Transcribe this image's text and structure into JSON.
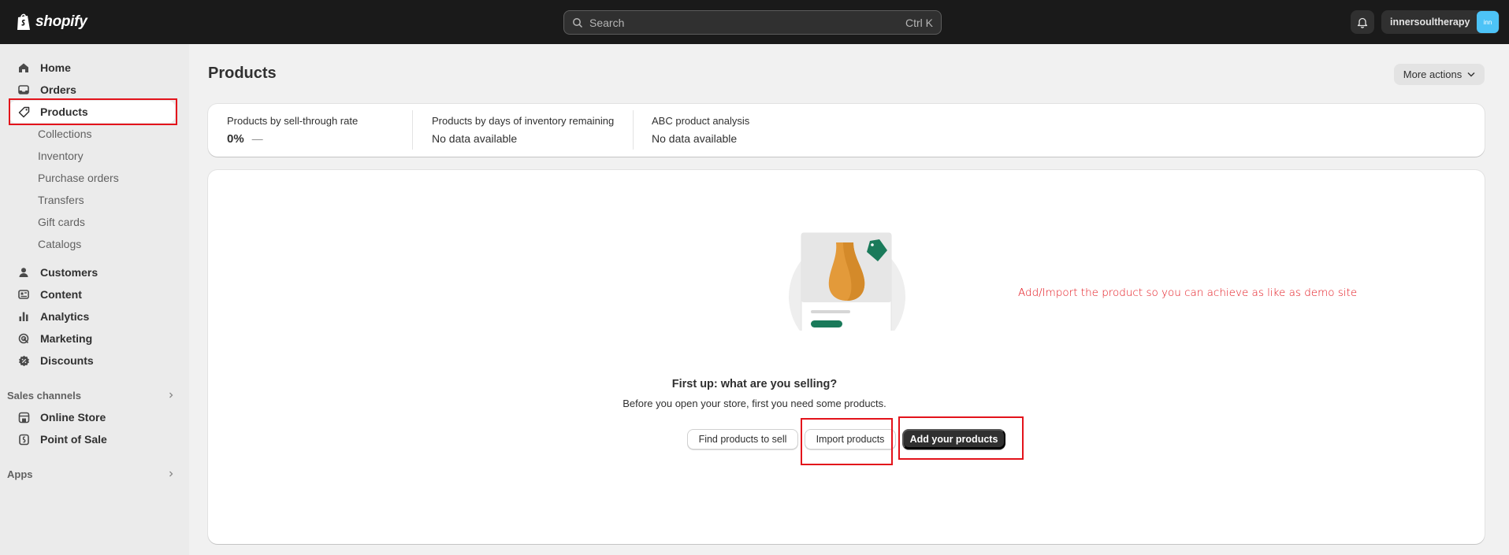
{
  "topbar": {
    "logo_text": "shopify",
    "search_placeholder": "Search",
    "search_shortcut": "Ctrl K",
    "store_name": "innersoultherapy",
    "avatar_initials": "inn"
  },
  "sidebar": {
    "main_items": [
      {
        "label": "Home",
        "icon": "home-icon"
      },
      {
        "label": "Orders",
        "icon": "inbox-icon"
      },
      {
        "label": "Products",
        "icon": "tag-icon",
        "active": true
      }
    ],
    "product_subitems": [
      "Collections",
      "Inventory",
      "Purchase orders",
      "Transfers",
      "Gift cards",
      "Catalogs"
    ],
    "more_items": [
      {
        "label": "Customers",
        "icon": "person-icon"
      },
      {
        "label": "Content",
        "icon": "content-icon"
      },
      {
        "label": "Analytics",
        "icon": "bar-chart-icon"
      },
      {
        "label": "Marketing",
        "icon": "target-icon"
      },
      {
        "label": "Discounts",
        "icon": "discount-icon"
      }
    ],
    "sales_channels_label": "Sales channels",
    "sales_channels": [
      {
        "label": "Online Store",
        "icon": "store-icon"
      },
      {
        "label": "Point of Sale",
        "icon": "pos-icon"
      }
    ],
    "apps_label": "Apps"
  },
  "main": {
    "title": "Products",
    "more_actions_label": "More actions",
    "metrics": [
      {
        "label": "Products by sell-through rate",
        "value": "0%",
        "trend": "—"
      },
      {
        "label": "Products by days of inventory remaining",
        "value": "No data available"
      },
      {
        "label": "ABC product analysis",
        "value": "No data available"
      }
    ],
    "empty_state": {
      "heading": "First up: what are you selling?",
      "subtext": "Before you open your store, first you need some products.",
      "find_button": "Find products to sell",
      "import_button": "Import products",
      "add_button": "Add your products"
    }
  },
  "annotation": {
    "text": "Add/Import the product so you can achieve as like as demo site",
    "color": "#e3131b"
  },
  "colors": {
    "topbar": "#1a1a1a",
    "sidebar": "#ebebeb",
    "page": "#f1f1f1",
    "primary_button": "#303030",
    "avatar": "#4dc3f7",
    "tag_green": "#1a7a5a",
    "bottle_orange": "#e39a3a"
  }
}
